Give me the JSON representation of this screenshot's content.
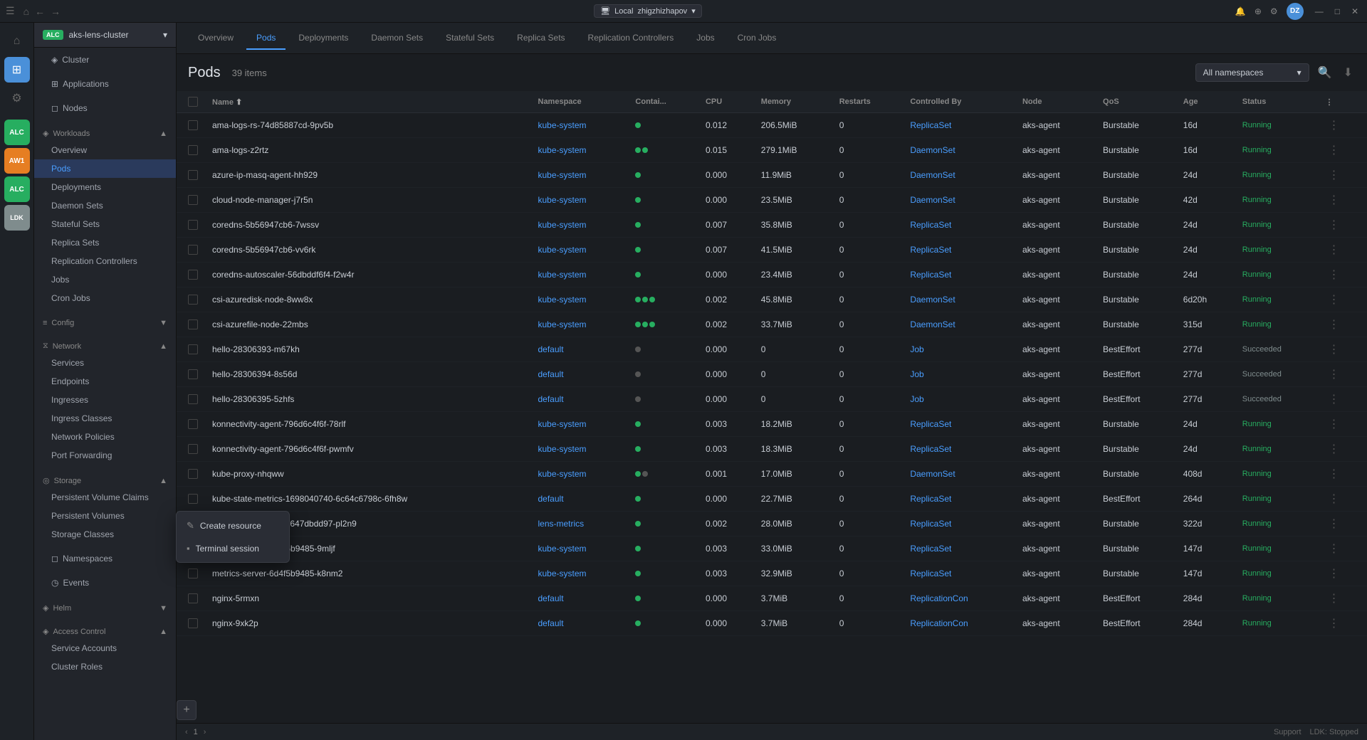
{
  "titleBar": {
    "navBack": "←",
    "navForward": "→",
    "homeIcon": "⌂",
    "hamburger": "☰",
    "clusterLabel": "Local",
    "clusterUser": "zhigzhizhapov",
    "avatar": "DZ",
    "windowControls": [
      "—",
      "□",
      "✕"
    ]
  },
  "iconSidebar": {
    "items": [
      {
        "id": "home",
        "icon": "⌂",
        "active": false
      },
      {
        "id": "grid",
        "icon": "⊞",
        "active": true
      },
      {
        "id": "settings",
        "icon": "⚙",
        "active": false
      },
      {
        "id": "alc",
        "label": "ALC",
        "active": true
      },
      {
        "id": "aw1",
        "label": "AW1",
        "active": false
      },
      {
        "id": "alc2",
        "label": "ALC",
        "active": false
      },
      {
        "id": "ldk",
        "label": "LDK",
        "active": false
      }
    ]
  },
  "sidebar": {
    "clusterBadge": "ALC",
    "clusterName": "aks-lens-cluster",
    "sections": [
      {
        "id": "cluster",
        "label": "Cluster",
        "icon": "◈",
        "items": []
      },
      {
        "id": "applications",
        "label": "Applications",
        "icon": "⊞",
        "items": []
      },
      {
        "id": "nodes",
        "label": "Nodes",
        "icon": "◻",
        "items": []
      },
      {
        "id": "workloads",
        "label": "Workloads",
        "icon": "◈",
        "expanded": true,
        "items": [
          {
            "id": "overview",
            "label": "Overview"
          },
          {
            "id": "pods",
            "label": "Pods",
            "active": true
          },
          {
            "id": "deployments",
            "label": "Deployments"
          },
          {
            "id": "daemon-sets",
            "label": "Daemon Sets"
          },
          {
            "id": "stateful-sets",
            "label": "Stateful Sets"
          },
          {
            "id": "replica-sets",
            "label": "Replica Sets"
          },
          {
            "id": "replication-controllers",
            "label": "Replication Controllers"
          },
          {
            "id": "jobs",
            "label": "Jobs"
          },
          {
            "id": "cron-jobs",
            "label": "Cron Jobs"
          }
        ]
      },
      {
        "id": "config",
        "label": "Config",
        "icon": "≡",
        "expanded": false,
        "items": []
      },
      {
        "id": "network",
        "label": "Network",
        "icon": "⧖",
        "expanded": true,
        "items": [
          {
            "id": "services",
            "label": "Services"
          },
          {
            "id": "endpoints",
            "label": "Endpoints"
          },
          {
            "id": "ingresses",
            "label": "Ingresses"
          },
          {
            "id": "ingress-classes",
            "label": "Ingress Classes"
          },
          {
            "id": "network-policies",
            "label": "Network Policies"
          },
          {
            "id": "port-forwarding",
            "label": "Port Forwarding"
          }
        ]
      },
      {
        "id": "storage",
        "label": "Storage",
        "icon": "◎",
        "expanded": true,
        "items": [
          {
            "id": "pvc",
            "label": "Persistent Volume Claims"
          },
          {
            "id": "pv",
            "label": "Persistent Volumes"
          },
          {
            "id": "storage-classes",
            "label": "Storage Classes"
          }
        ]
      },
      {
        "id": "namespaces",
        "label": "Namespaces",
        "icon": "◻",
        "items": []
      },
      {
        "id": "events",
        "label": "Events",
        "icon": "◷",
        "items": []
      },
      {
        "id": "helm",
        "label": "Helm",
        "icon": "◈",
        "expanded": false,
        "items": []
      },
      {
        "id": "access-control",
        "label": "Access Control",
        "icon": "◈",
        "expanded": true,
        "items": [
          {
            "id": "service-accounts",
            "label": "Service Accounts"
          },
          {
            "id": "cluster-roles",
            "label": "Cluster Roles"
          }
        ]
      }
    ]
  },
  "tabs": [
    {
      "id": "overview",
      "label": "Overview"
    },
    {
      "id": "pods",
      "label": "Pods",
      "active": true
    },
    {
      "id": "deployments",
      "label": "Deployments"
    },
    {
      "id": "daemon-sets",
      "label": "Daemon Sets"
    },
    {
      "id": "stateful-sets",
      "label": "Stateful Sets"
    },
    {
      "id": "replica-sets",
      "label": "Replica Sets"
    },
    {
      "id": "replication-controllers",
      "label": "Replication Controllers"
    },
    {
      "id": "jobs",
      "label": "Jobs"
    },
    {
      "id": "cron-jobs",
      "label": "Cron Jobs"
    }
  ],
  "podsView": {
    "title": "Pods",
    "itemCount": "39 items",
    "namespaceFilter": "All namespaces",
    "columns": [
      "Name",
      "Namespace",
      "Contai...",
      "CPU",
      "Memory",
      "Restarts",
      "Controlled By",
      "Node",
      "QoS",
      "Age",
      "Status"
    ],
    "rows": [
      {
        "name": "ama-logs-rs-74d85887cd-9pv5b",
        "namespace": "kube-system",
        "containers": [
          {
            "color": "green"
          }
        ],
        "cpu": "0.012",
        "memory": "206.5MiB",
        "restarts": "0",
        "controlledBy": "ReplicaSet",
        "node": "aks-agent",
        "qos": "Burstable",
        "age": "16d",
        "status": "Running"
      },
      {
        "name": "ama-logs-z2rtz",
        "namespace": "kube-system",
        "containers": [
          {
            "color": "green"
          },
          {
            "color": "green"
          }
        ],
        "cpu": "0.015",
        "memory": "279.1MiB",
        "restarts": "0",
        "controlledBy": "DaemonSet",
        "node": "aks-agent",
        "qos": "Burstable",
        "age": "16d",
        "status": "Running"
      },
      {
        "name": "azure-ip-masq-agent-hh929",
        "namespace": "kube-system",
        "containers": [
          {
            "color": "green"
          }
        ],
        "cpu": "0.000",
        "memory": "11.9MiB",
        "restarts": "0",
        "controlledBy": "DaemonSet",
        "node": "aks-agent",
        "qos": "Burstable",
        "age": "24d",
        "status": "Running"
      },
      {
        "name": "cloud-node-manager-j7r5n",
        "namespace": "kube-system",
        "containers": [
          {
            "color": "green"
          }
        ],
        "cpu": "0.000",
        "memory": "23.5MiB",
        "restarts": "0",
        "controlledBy": "DaemonSet",
        "node": "aks-agent",
        "qos": "Burstable",
        "age": "42d",
        "status": "Running"
      },
      {
        "name": "coredns-5b56947cb6-7wssv",
        "namespace": "kube-system",
        "containers": [
          {
            "color": "green"
          }
        ],
        "cpu": "0.007",
        "memory": "35.8MiB",
        "restarts": "0",
        "controlledBy": "ReplicaSet",
        "node": "aks-agent",
        "qos": "Burstable",
        "age": "24d",
        "status": "Running"
      },
      {
        "name": "coredns-5b56947cb6-vv6rk",
        "namespace": "kube-system",
        "containers": [
          {
            "color": "green"
          }
        ],
        "cpu": "0.007",
        "memory": "41.5MiB",
        "restarts": "0",
        "controlledBy": "ReplicaSet",
        "node": "aks-agent",
        "qos": "Burstable",
        "age": "24d",
        "status": "Running"
      },
      {
        "name": "coredns-autoscaler-56dbddf6f4-f2w4r",
        "namespace": "kube-system",
        "containers": [
          {
            "color": "green"
          }
        ],
        "cpu": "0.000",
        "memory": "23.4MiB",
        "restarts": "0",
        "controlledBy": "ReplicaSet",
        "node": "aks-agent",
        "qos": "Burstable",
        "age": "24d",
        "status": "Running"
      },
      {
        "name": "csi-azuredisk-node-8ww8x",
        "namespace": "kube-system",
        "containers": [
          {
            "color": "green"
          },
          {
            "color": "green"
          },
          {
            "color": "green"
          }
        ],
        "cpu": "0.002",
        "memory": "45.8MiB",
        "restarts": "0",
        "controlledBy": "DaemonSet",
        "node": "aks-agent",
        "qos": "Burstable",
        "age": "6d20h",
        "status": "Running"
      },
      {
        "name": "csi-azurefile-node-22mbs",
        "namespace": "kube-system",
        "containers": [
          {
            "color": "green"
          },
          {
            "color": "green"
          },
          {
            "color": "green"
          }
        ],
        "cpu": "0.002",
        "memory": "33.7MiB",
        "restarts": "0",
        "controlledBy": "DaemonSet",
        "node": "aks-agent",
        "qos": "Burstable",
        "age": "315d",
        "status": "Running"
      },
      {
        "name": "hello-28306393-m67kh",
        "namespace": "default",
        "containers": [
          {
            "color": "gray"
          }
        ],
        "cpu": "0.000",
        "memory": "0",
        "restarts": "0",
        "controlledBy": "Job",
        "node": "aks-agent",
        "qos": "BestEffort",
        "age": "277d",
        "status": "Succeeded"
      },
      {
        "name": "hello-28306394-8s56d",
        "namespace": "default",
        "containers": [
          {
            "color": "gray"
          }
        ],
        "cpu": "0.000",
        "memory": "0",
        "restarts": "0",
        "controlledBy": "Job",
        "node": "aks-agent",
        "qos": "BestEffort",
        "age": "277d",
        "status": "Succeeded"
      },
      {
        "name": "hello-28306395-5zhfs",
        "namespace": "default",
        "containers": [
          {
            "color": "gray"
          }
        ],
        "cpu": "0.000",
        "memory": "0",
        "restarts": "0",
        "controlledBy": "Job",
        "node": "aks-agent",
        "qos": "BestEffort",
        "age": "277d",
        "status": "Succeeded"
      },
      {
        "name": "konnectivity-agent-796d6c4f6f-78rlf",
        "namespace": "kube-system",
        "containers": [
          {
            "color": "green"
          }
        ],
        "cpu": "0.003",
        "memory": "18.2MiB",
        "restarts": "0",
        "controlledBy": "ReplicaSet",
        "node": "aks-agent",
        "qos": "Burstable",
        "age": "24d",
        "status": "Running"
      },
      {
        "name": "konnectivity-agent-796d6c4f6f-pwmfv",
        "namespace": "kube-system",
        "containers": [
          {
            "color": "green"
          }
        ],
        "cpu": "0.003",
        "memory": "18.3MiB",
        "restarts": "0",
        "controlledBy": "ReplicaSet",
        "node": "aks-agent",
        "qos": "Burstable",
        "age": "24d",
        "status": "Running"
      },
      {
        "name": "kube-proxy-nhqww",
        "namespace": "kube-system",
        "containers": [
          {
            "color": "green"
          },
          {
            "color": "gray"
          }
        ],
        "cpu": "0.001",
        "memory": "17.0MiB",
        "restarts": "0",
        "controlledBy": "DaemonSet",
        "node": "aks-agent",
        "qos": "Burstable",
        "age": "408d",
        "status": "Running"
      },
      {
        "name": "kube-state-metrics-1698040740-6c64c6798c-6fh8w",
        "namespace": "default",
        "containers": [
          {
            "color": "green"
          }
        ],
        "cpu": "0.000",
        "memory": "22.7MiB",
        "restarts": "0",
        "controlledBy": "ReplicaSet",
        "node": "aks-agent",
        "qos": "BestEffort",
        "age": "264d",
        "status": "Running"
      },
      {
        "name": "kube-state-metrics-5647dbdd97-pl2n9",
        "namespace": "lens-metrics",
        "containers": [
          {
            "color": "green"
          }
        ],
        "cpu": "0.002",
        "memory": "28.0MiB",
        "restarts": "0",
        "controlledBy": "ReplicaSet",
        "node": "aks-agent",
        "qos": "Burstable",
        "age": "322d",
        "status": "Running"
      },
      {
        "name": "metrics-server-6d4f5b9485-9mljf",
        "namespace": "kube-system",
        "containers": [
          {
            "color": "green"
          }
        ],
        "cpu": "0.003",
        "memory": "33.0MiB",
        "restarts": "0",
        "controlledBy": "ReplicaSet",
        "node": "aks-agent",
        "qos": "Burstable",
        "age": "147d",
        "status": "Running"
      },
      {
        "name": "metrics-server-6d4f5b9485-k8nm2",
        "namespace": "kube-system",
        "containers": [
          {
            "color": "green"
          }
        ],
        "cpu": "0.003",
        "memory": "32.9MiB",
        "restarts": "0",
        "controlledBy": "ReplicaSet",
        "node": "aks-agent",
        "qos": "Burstable",
        "age": "147d",
        "status": "Running"
      },
      {
        "name": "nginx-5rmxn",
        "namespace": "default",
        "containers": [
          {
            "color": "green"
          }
        ],
        "cpu": "0.000",
        "memory": "3.7MiB",
        "restarts": "0",
        "controlledBy": "ReplicationCon",
        "node": "aks-agent",
        "qos": "BestEffort",
        "age": "284d",
        "status": "Running"
      },
      {
        "name": "nginx-9xk2p",
        "namespace": "default",
        "containers": [
          {
            "color": "green"
          }
        ],
        "cpu": "0.000",
        "memory": "3.7MiB",
        "restarts": "0",
        "controlledBy": "ReplicationCon",
        "node": "aks-agent",
        "qos": "BestEffort",
        "age": "284d",
        "status": "Running"
      }
    ]
  },
  "contextMenu": {
    "items": [
      {
        "id": "create-resource",
        "icon": "✎",
        "label": "Create resource"
      },
      {
        "id": "terminal-session",
        "icon": "⬛",
        "label": "Terminal session"
      }
    ]
  },
  "bottomBar": {
    "prevPage": "‹",
    "pageNum": "1",
    "nextPage": "›",
    "supportLabel": "Support",
    "ldkLabel": "LDK: Stopped"
  }
}
